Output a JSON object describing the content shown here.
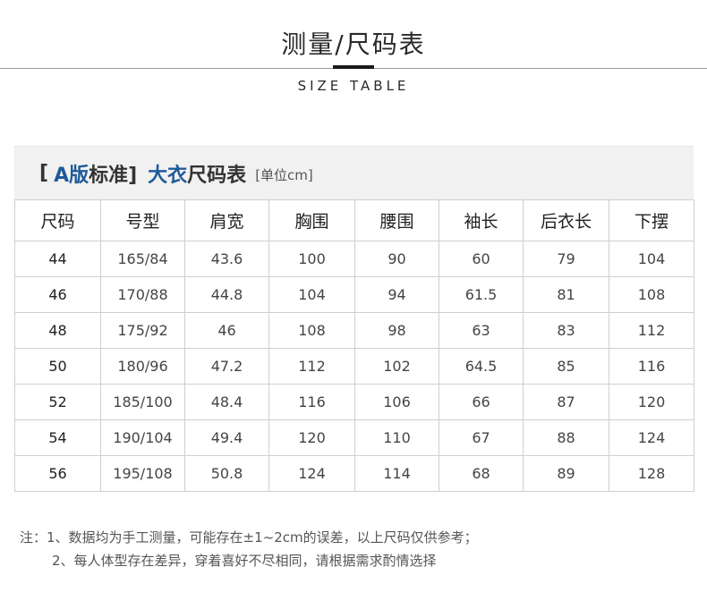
{
  "header": {
    "title": "测量/尺码表",
    "subtitle": "SIZE TABLE"
  },
  "caption": {
    "open_bracket": "[",
    "version": "A版",
    "standard": "标准]",
    "item": "大衣",
    "table_word": "尺码表",
    "unit": "[单位cm]"
  },
  "table": {
    "columns": [
      "尺码",
      "号型",
      "肩宽",
      "胸围",
      "腰围",
      "袖长",
      "后衣长",
      "下摆"
    ],
    "rows": [
      [
        "44",
        "165/84",
        "43.6",
        "100",
        "90",
        "60",
        "79",
        "104"
      ],
      [
        "46",
        "170/88",
        "44.8",
        "104",
        "94",
        "61.5",
        "81",
        "108"
      ],
      [
        "48",
        "175/92",
        "46",
        "108",
        "98",
        "63",
        "83",
        "112"
      ],
      [
        "50",
        "180/96",
        "47.2",
        "112",
        "102",
        "64.5",
        "85",
        "116"
      ],
      [
        "52",
        "185/100",
        "48.4",
        "116",
        "106",
        "66",
        "87",
        "120"
      ],
      [
        "54",
        "190/104",
        "49.4",
        "120",
        "110",
        "67",
        "88",
        "124"
      ],
      [
        "56",
        "195/108",
        "50.8",
        "124",
        "114",
        "68",
        "89",
        "128"
      ]
    ]
  },
  "notes": {
    "line1": "注：1、数据均为手工测量，可能存在±1~2cm的误差，以上尺码仅供参考；",
    "line2": "2、每人体型存在差异，穿着喜好不尽相同，请根据需求酌情选择"
  },
  "colors": {
    "accent_blue": "#1f5a99",
    "caption_bg": "#f1f1f1",
    "grid_line": "#cfcfcf"
  }
}
